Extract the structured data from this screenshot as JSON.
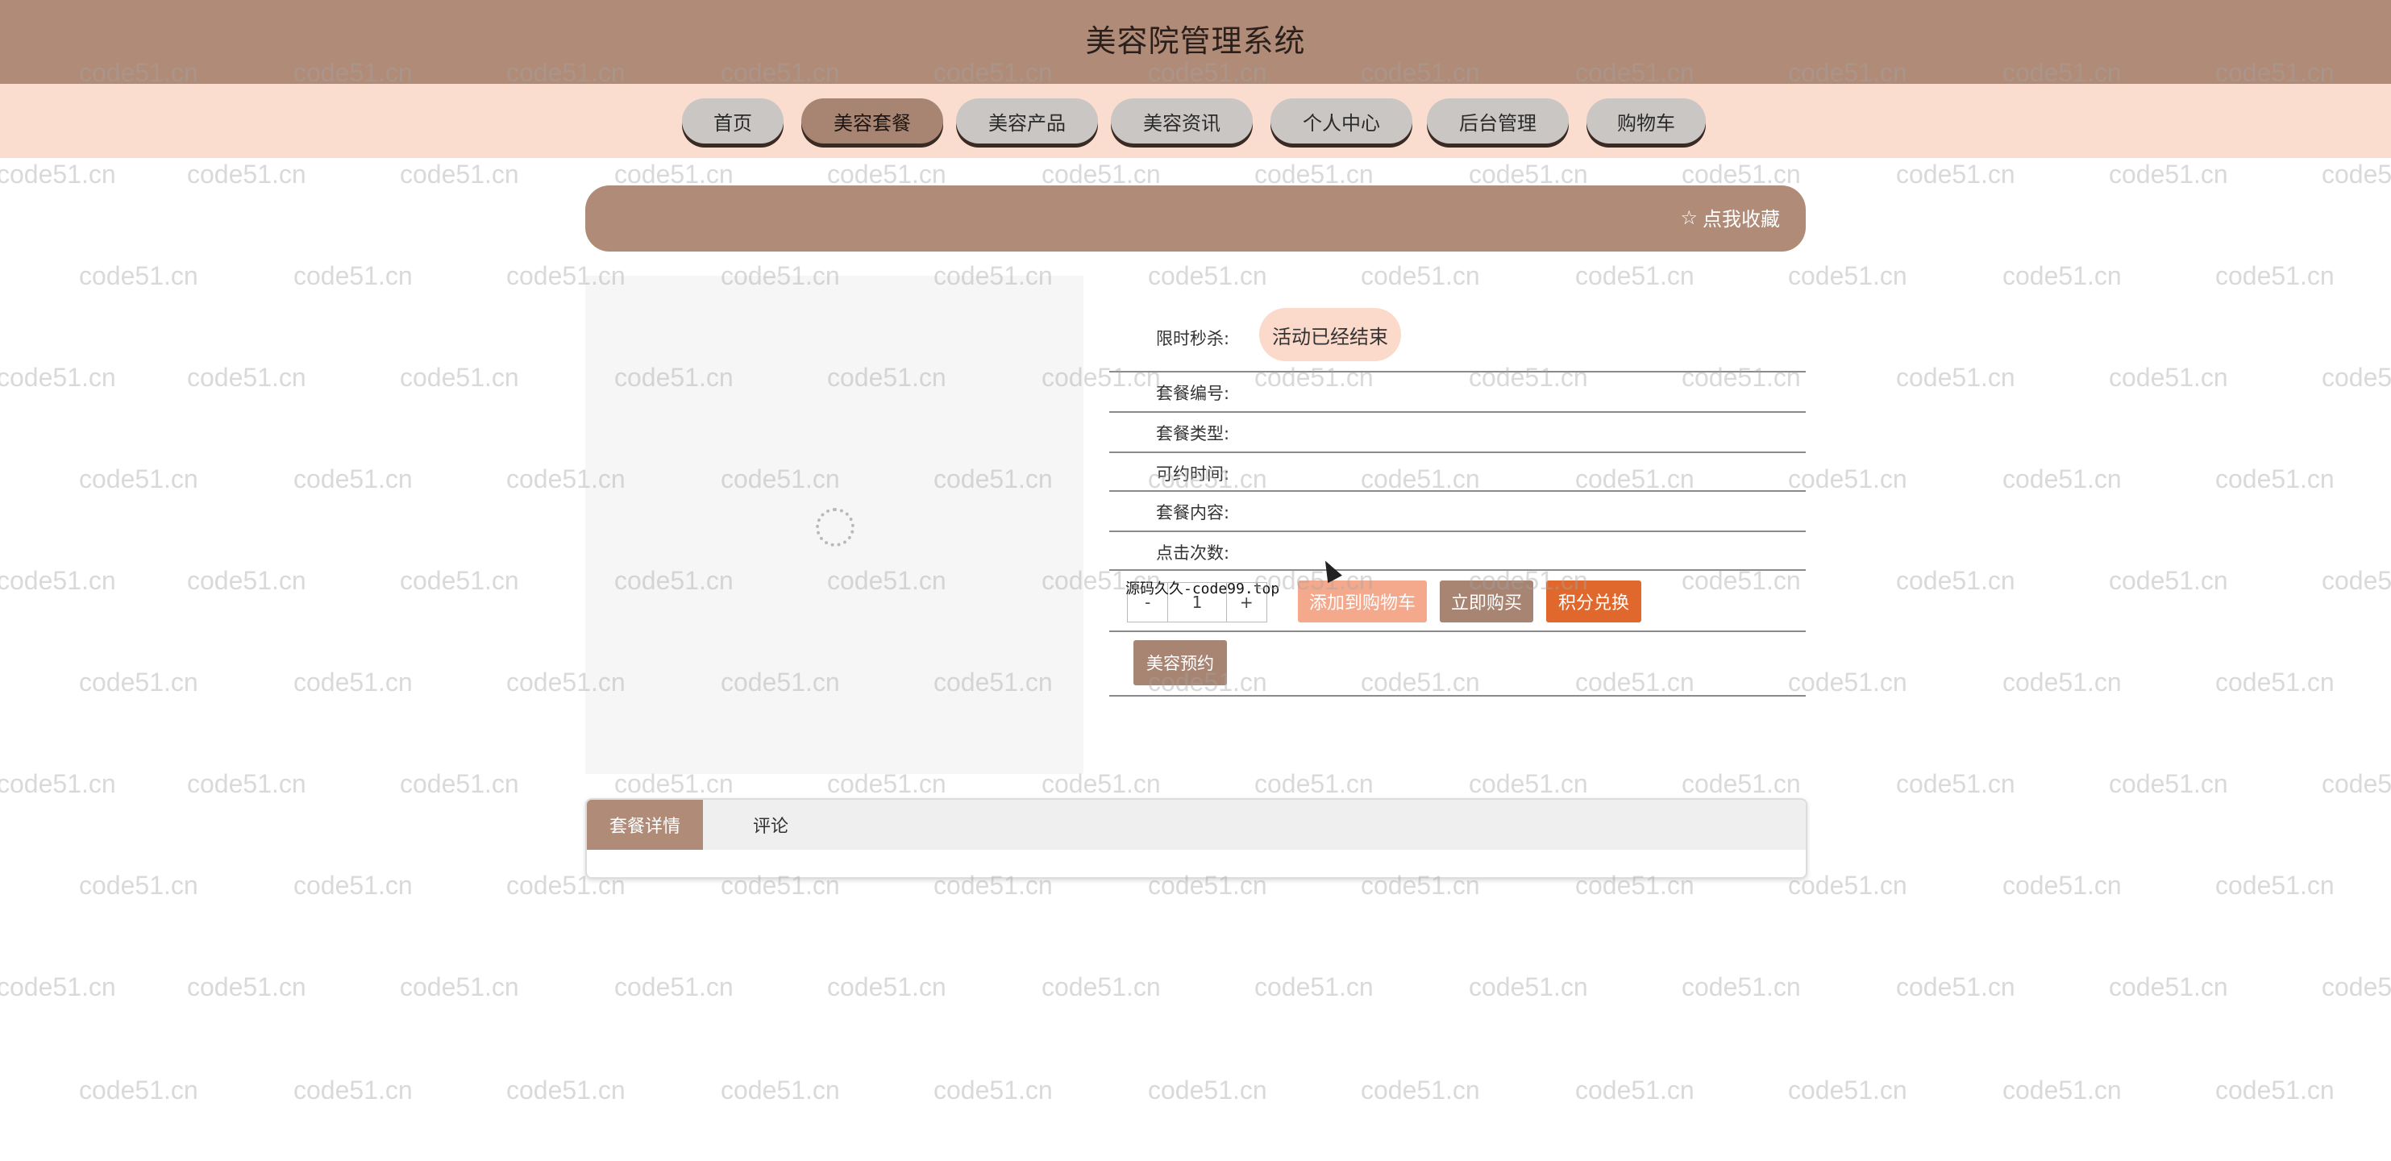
{
  "header": {
    "title": "美容院管理系统"
  },
  "nav": {
    "items": [
      {
        "label": "首页"
      },
      {
        "label": "美容套餐"
      },
      {
        "label": "美容产品"
      },
      {
        "label": "美容资讯"
      },
      {
        "label": "个人中心"
      },
      {
        "label": "后台管理"
      },
      {
        "label": "购物车"
      }
    ],
    "active_index": 1
  },
  "favorite": {
    "icon": "star-outline-icon",
    "label": "点我收藏"
  },
  "detail": {
    "flash_sale_label": "限时秒杀:",
    "flash_sale_status": "活动已经结束",
    "fields": [
      {
        "label": "套餐编号:"
      },
      {
        "label": "套餐类型:"
      },
      {
        "label": "可约时间:"
      },
      {
        "label": "套餐内容:"
      },
      {
        "label": "点击次数:"
      }
    ],
    "quantity": {
      "minus": "-",
      "value": "1",
      "plus": "+"
    },
    "overlay_text": "源码久久-code99.top",
    "buttons": {
      "add_to_cart": "添加到购物车",
      "buy_now": "立即购买",
      "points_redeem": "积分兑换",
      "book": "美容预约"
    }
  },
  "tabs": [
    {
      "label": "套餐详情"
    },
    {
      "label": "评论"
    }
  ],
  "watermark": "code51.cn",
  "colors": {
    "brand_brown": "#b08b78",
    "nav_pink": "#fbddd0",
    "add_to_cart": "#f4a98c",
    "buy_now": "#a88472",
    "points_redeem": "#e0682d"
  }
}
